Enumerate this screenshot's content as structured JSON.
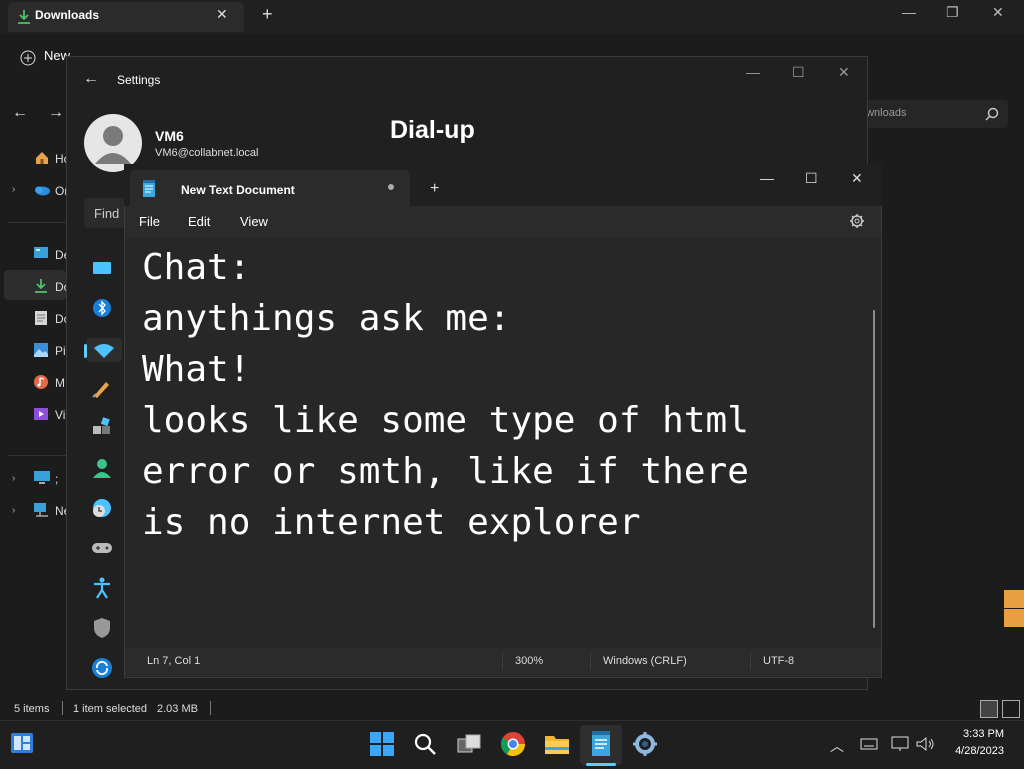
{
  "explorer": {
    "tab_title": "Downloads",
    "new_label": "New",
    "search_placeholder": "ownloads",
    "sidebar": [
      {
        "label": "Ho",
        "icon": "home-icon"
      },
      {
        "label": "Or",
        "icon": "onedrive-icon"
      },
      {
        "label": "De",
        "icon": "desktop-icon"
      },
      {
        "label": "Do",
        "icon": "downloads-icon"
      },
      {
        "label": "Do",
        "icon": "documents-icon"
      },
      {
        "label": "Pi",
        "icon": "pictures-icon"
      },
      {
        "label": "M",
        "icon": "music-icon"
      },
      {
        "label": "Vi",
        "icon": "videos-icon"
      },
      {
        "label": ";",
        "icon": "this-pc-icon"
      },
      {
        "label": "Ne",
        "icon": "network-icon"
      }
    ],
    "status": {
      "items": "5 items",
      "selected": "1 item selected",
      "size": "2.03 MB"
    }
  },
  "settings": {
    "title": "Settings",
    "user_name": "VM6",
    "user_email": "VM6@collabnet.local",
    "heading": "Dial-up",
    "find_placeholder": "Find",
    "nav_icons": [
      "system-icon",
      "bluetooth-icon",
      "network-icon",
      "personalization-icon",
      "apps-icon",
      "accounts-icon",
      "time-language-icon",
      "gaming-icon",
      "accessibility-icon",
      "privacy-icon",
      "windows-update-icon"
    ]
  },
  "notepad": {
    "tab_title": "New Text Document",
    "menu": [
      "File",
      "Edit",
      "View"
    ],
    "content": "Chat:\nanythings ask me:\nWhat!\nlooks like some type of html\nerror or smth, like if there\nis no internet explorer",
    "status": {
      "position": "Ln 7, Col 1",
      "zoom": "300%",
      "line_ending": "Windows (CRLF)",
      "encoding": "UTF-8"
    }
  },
  "taskbar": {
    "time": "3:33 PM",
    "date": "4/28/2023",
    "apps": [
      "start-icon",
      "search-icon",
      "task-view-icon",
      "chrome-icon",
      "file-explorer-icon",
      "notepad-icon",
      "settings-icon"
    ]
  },
  "colors": {
    "accent": "#60cdff",
    "window_bg": "#202020",
    "editor_bg": "#272727"
  }
}
